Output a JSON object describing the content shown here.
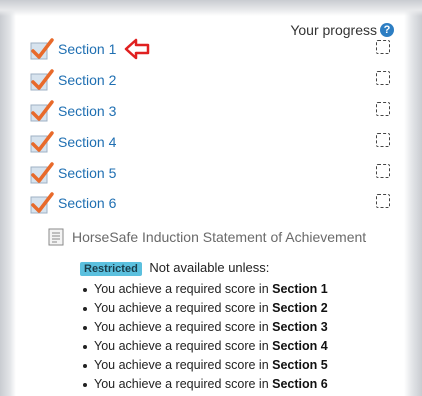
{
  "progress_header": {
    "label": "Your progress",
    "help_icon": "question-circle-icon",
    "help_glyph": "?"
  },
  "sections": [
    {
      "label": "Section 1",
      "has_pointer_arrow": true
    },
    {
      "label": "Section 2"
    },
    {
      "label": "Section 3"
    },
    {
      "label": "Section 4"
    },
    {
      "label": "Section 5"
    },
    {
      "label": "Section 6"
    }
  ],
  "activity": {
    "icon": "document-icon",
    "title": "HorseSafe Induction Statement of Achievement"
  },
  "restriction": {
    "badge": "Restricted",
    "intro": "Not available unless:",
    "prefix": "You achieve a required score in",
    "conditions": [
      "Section 1",
      "Section 2",
      "Section 3",
      "Section 4",
      "Section 5",
      "Section 6"
    ]
  },
  "colors": {
    "link": "#1f6fb2",
    "check": "#e86a2b",
    "badge": "#5bc0de",
    "help": "#2d7ec3",
    "arrow": "#e02020"
  }
}
